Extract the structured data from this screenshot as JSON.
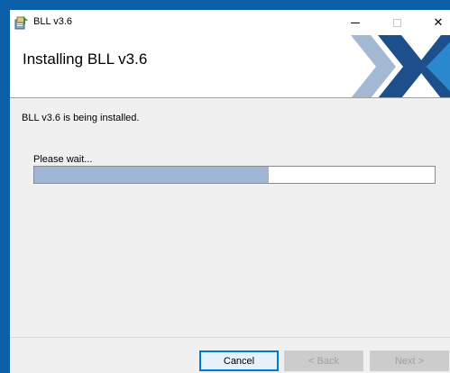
{
  "window": {
    "title": "BLL v3.6",
    "controls": {
      "minimize": "minimize",
      "maximize": "maximize",
      "close": "✕"
    }
  },
  "banner": {
    "title": "Installing BLL v3.6",
    "logo_colors": {
      "dark": "#1d4f8c",
      "light": "#a3b9d3",
      "accent": "#2a88cf"
    }
  },
  "content": {
    "status_message": "BLL v3.6 is being installed.",
    "wait_label": "Please wait...",
    "progress_fraction": 0.585
  },
  "buttons": {
    "cancel": "Cancel",
    "back": "< Back",
    "next": "Next >"
  },
  "icons": {
    "app": "installer-package-icon",
    "minimize": "minimize-icon",
    "maximize": "maximize-icon",
    "close": "close-icon"
  }
}
